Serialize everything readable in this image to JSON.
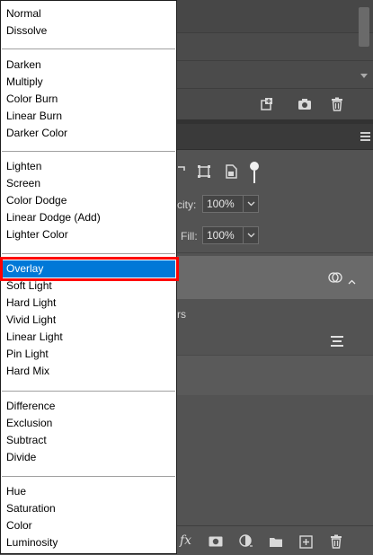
{
  "layers_panel": {
    "opacity_label": "city:",
    "opacity_value": "100%",
    "fill_label": "Fill:",
    "fill_value": "100%",
    "layer_partial_text": "rs"
  },
  "blend_menu": {
    "selected": "Overlay",
    "groups": [
      [
        "Normal",
        "Dissolve"
      ],
      [
        "Darken",
        "Multiply",
        "Color Burn",
        "Linear Burn",
        "Darker Color"
      ],
      [
        "Lighten",
        "Screen",
        "Color Dodge",
        "Linear Dodge (Add)",
        "Lighter Color"
      ],
      [
        "Overlay",
        "Soft Light",
        "Hard Light",
        "Vivid Light",
        "Linear Light",
        "Pin Light",
        "Hard Mix"
      ],
      [
        "Difference",
        "Exclusion",
        "Subtract",
        "Divide"
      ],
      [
        "Hue",
        "Saturation",
        "Color",
        "Luminosity"
      ]
    ]
  },
  "icons": {
    "history_bottom": [
      "new-snapshot-icon",
      "camera-icon",
      "trash-icon"
    ],
    "layers_bottom": [
      "fx-icon",
      "mask-icon",
      "adjustment-icon",
      "folder-icon",
      "new-layer-icon",
      "trash-icon"
    ],
    "fx_text": "fx"
  },
  "colors": {
    "panel_bg": "#535353",
    "menu_selection": "#0078d7",
    "annotation_box": "#ff0000"
  }
}
